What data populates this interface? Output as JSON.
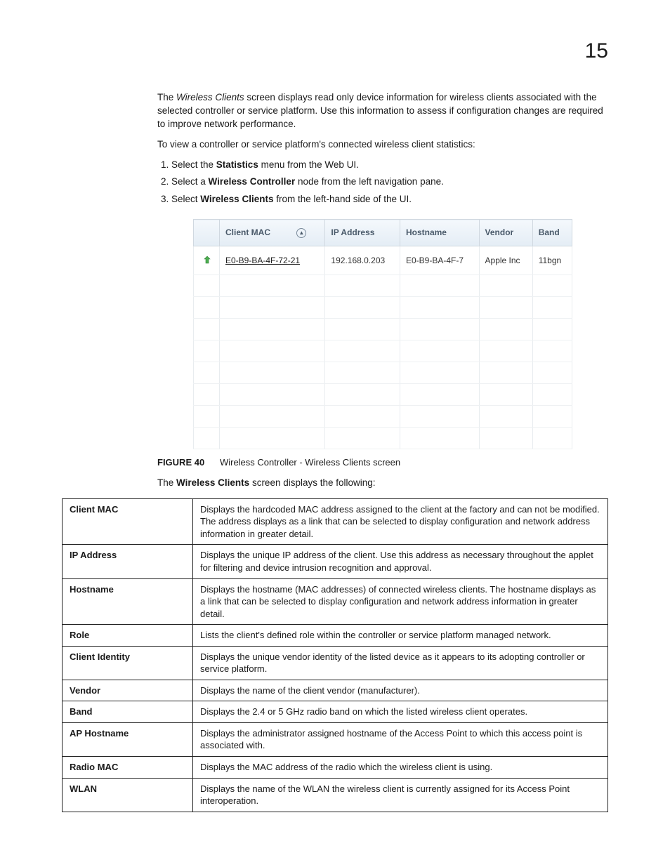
{
  "chapter_number": "15",
  "intro_p1_pre": "The ",
  "intro_p1_em": "Wireless Clients",
  "intro_p1_post": " screen displays read only device information for wireless clients associated with the selected controller or service platform. Use this information to assess if configuration changes are required to improve network performance.",
  "intro_p2": "To view a controller or service platform's connected wireless client statistics:",
  "steps": {
    "s1_pre": "Select the ",
    "s1_b": "Statistics",
    "s1_post": " menu from the Web UI.",
    "s2_pre": "Select a ",
    "s2_b": "Wireless Controller",
    "s2_post": " node from the left navigation pane.",
    "s3_pre": "Select ",
    "s3_b": "Wireless Clients",
    "s3_post": " from the left-hand side of the UI."
  },
  "screenshot": {
    "headers": {
      "icon": "",
      "mac": "Client MAC",
      "ip": "IP Address",
      "host": "Hostname",
      "vendor": "Vendor",
      "band": "Band"
    },
    "row": {
      "mac": "E0-B9-BA-4F-72-21",
      "ip": "192.168.0.203",
      "host": "E0-B9-BA-4F-7",
      "vendor": "Apple Inc",
      "band": "11bgn"
    }
  },
  "figure": {
    "label": "FIGURE 40",
    "text": "Wireless Controller - Wireless Clients screen"
  },
  "after_fig_pre": "The ",
  "after_fig_b": "Wireless Clients",
  "after_fig_post": " screen displays the following:",
  "desc": [
    {
      "term": "Client MAC",
      "def": "Displays the hardcoded MAC address assigned to the client at the factory and can not be modified. The address displays as a link that can be selected to display configuration and network address information in greater detail."
    },
    {
      "term": "IP Address",
      "def": "Displays the unique IP address of the client. Use this address as necessary throughout the applet for filtering and device intrusion recognition and approval."
    },
    {
      "term": "Hostname",
      "def": "Displays the hostname (MAC addresses) of connected wireless clients. The hostname displays as a link that can be selected to display configuration and network address information in greater detail."
    },
    {
      "term": "Role",
      "def": "Lists the client's defined role within the controller or service platform managed network."
    },
    {
      "term": "Client Identity",
      "def": "Displays the unique vendor identity of the listed device as it appears to its adopting controller or service platform."
    },
    {
      "term": "Vendor",
      "def": "Displays the name of the client vendor (manufacturer)."
    },
    {
      "term": "Band",
      "def": "Displays the 2.4 or 5 GHz radio band on which the listed wireless client operates."
    },
    {
      "term": "AP Hostname",
      "def": "Displays the administrator assigned hostname of the Access Point to which this access point is associated with."
    },
    {
      "term": "Radio MAC",
      "def": "Displays the MAC address of the radio which the wireless client is using."
    },
    {
      "term": "WLAN",
      "def": "Displays the name of the WLAN the wireless client is currently assigned for its Access Point interoperation."
    }
  ]
}
